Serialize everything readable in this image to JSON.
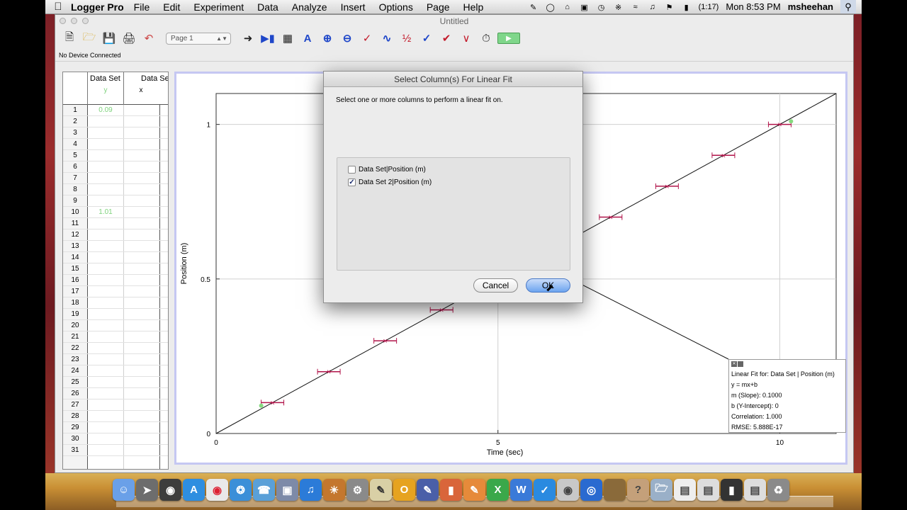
{
  "menubar": {
    "app": "Logger Pro",
    "items": [
      "File",
      "Edit",
      "Experiment",
      "Data",
      "Analyze",
      "Insert",
      "Options",
      "Page",
      "Help"
    ],
    "battery": "(1:17)",
    "clock": "Mon 8:53 PM",
    "user": "msheehan"
  },
  "window": {
    "title": "Untitled",
    "page_select": "Page 1",
    "status": "No Device Connected"
  },
  "table": {
    "columns": [
      {
        "set": "Data Set",
        "symbol": "y"
      },
      {
        "set": "Data Se",
        "symbol": "x"
      }
    ],
    "rows": [
      "1",
      "2",
      "3",
      "4",
      "5",
      "6",
      "7",
      "8",
      "9",
      "10",
      "11",
      "12",
      "13",
      "14",
      "15",
      "16",
      "17",
      "18",
      "19",
      "20",
      "21",
      "22",
      "23",
      "24",
      "25",
      "26",
      "27",
      "28",
      "29",
      "30",
      "31"
    ],
    "values": {
      "1": "0.09",
      "10": "1.01"
    }
  },
  "chart_data": {
    "type": "scatter",
    "xlabel": "Time (sec)",
    "ylabel": "Position (m)",
    "xlim": [
      0,
      11
    ],
    "ylim": [
      0,
      1.1
    ],
    "xticks": [
      "0",
      "5",
      "10"
    ],
    "yticks": [
      "0",
      "0.5",
      "1"
    ],
    "series": [
      {
        "name": "Data Set 2",
        "color": "#b1144a",
        "x": [
          1,
          2,
          3,
          4,
          5,
          6,
          7,
          8,
          9,
          10
        ],
        "y": [
          0.1,
          0.2,
          0.3,
          0.4,
          0.5,
          0.6,
          0.7,
          0.8,
          0.9,
          1.0
        ]
      },
      {
        "name": "Data Set",
        "color": "#86d97f",
        "x": [
          0.8,
          10.2
        ],
        "y": [
          0.09,
          1.01
        ]
      }
    ],
    "fit_line": {
      "slope": 0.1,
      "intercept": 0
    }
  },
  "fit_box": {
    "lines": [
      "Linear Fit for: Data Set | Position (m)",
      "y = mx+b",
      "m (Slope): 0.1000",
      "b (Y-Intercept): 0",
      "Correlation: 1.000",
      "RMSE: 5.888E-17"
    ]
  },
  "dialog": {
    "title": "Select Column(s) For Linear Fit",
    "prompt": "Select one or more columns to perform a linear fit on.",
    "options": [
      {
        "label": "Data Set|Position (m)",
        "checked": false
      },
      {
        "label": "Data Set 2|Position (m)",
        "checked": true
      }
    ],
    "cancel": "Cancel",
    "ok": "OK"
  },
  "colors": {
    "accent": "#6ca4ef",
    "graph_border": "#c5c7f2"
  }
}
